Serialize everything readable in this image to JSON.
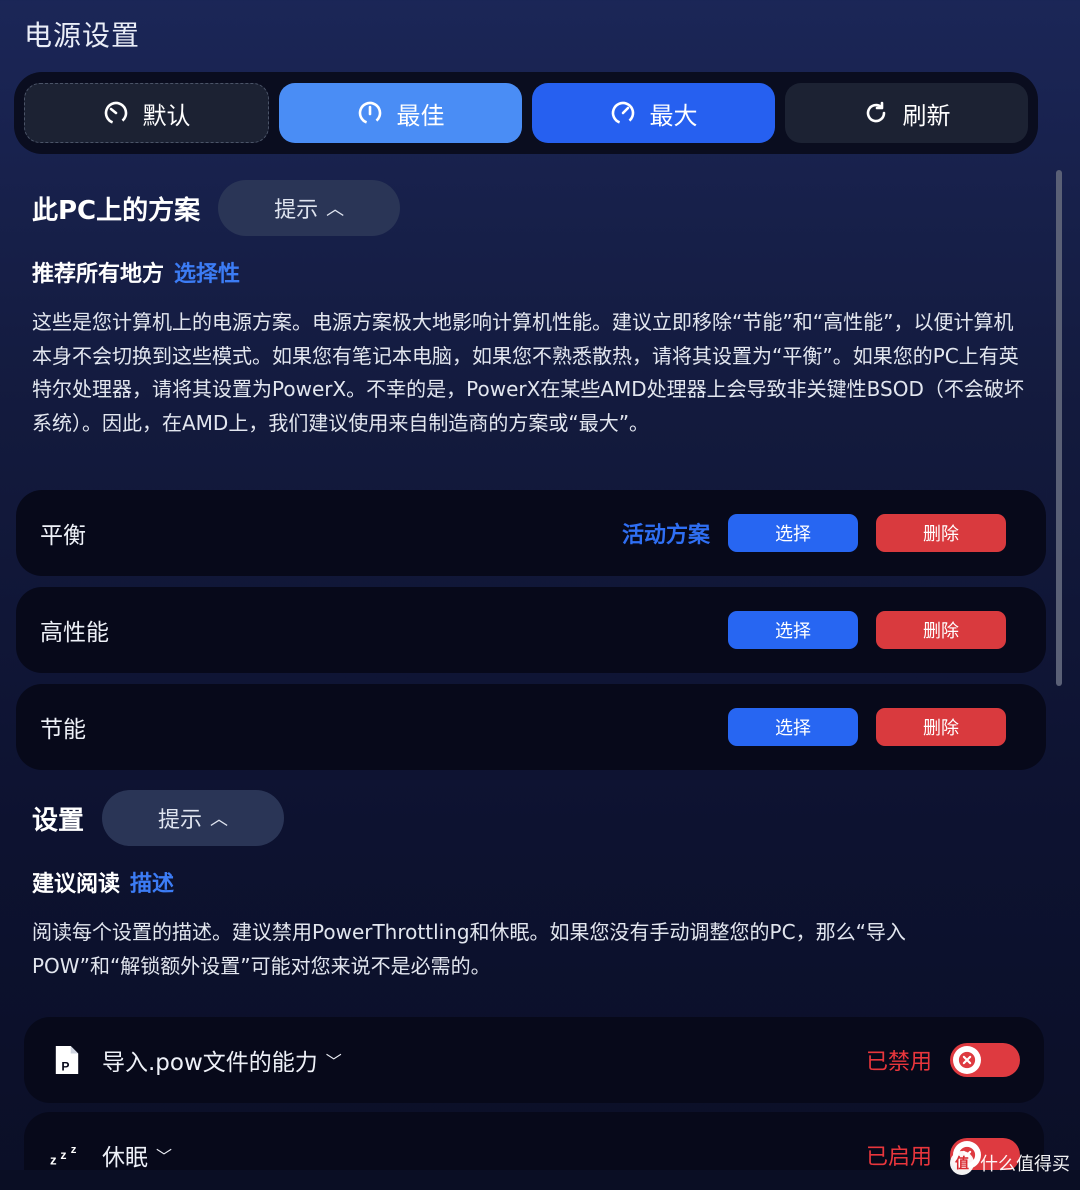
{
  "page": {
    "title": "电源设置"
  },
  "modes": [
    {
      "label": "默认",
      "icon": "gauge-low-icon"
    },
    {
      "label": "最佳",
      "icon": "gauge-mid-icon"
    },
    {
      "label": "最大",
      "icon": "gauge-high-icon"
    },
    {
      "label": "刷新",
      "icon": "refresh-icon"
    }
  ],
  "plans_section": {
    "title": "此PC上的方案",
    "hint_label": "提示",
    "recommend_label": "推荐所有地方",
    "recommend_link": "选择性",
    "description": "这些是您计算机上的电源方案。电源方案极大地影响计算机性能。建议立即移除“节能”和“高性能”，以便计算机本身不会切换到这些模式。如果您有笔记本电脑，如果您不熟悉散热，请将其设置为“平衡”。如果您的PC上有英特尔处理器，请将其设置为PowerX。不幸的是，PowerX在某些AMD处理器上会导致非关键性BSOD（不会破坏系统）。因此，在AMD上，我们建议使用来自制造商的方案或“最大”。",
    "plans": [
      {
        "name": "平衡",
        "active_label": "活动方案",
        "select_label": "选择",
        "delete_label": "删除"
      },
      {
        "name": "高性能",
        "active_label": "",
        "select_label": "选择",
        "delete_label": "删除"
      },
      {
        "name": "节能",
        "active_label": "",
        "select_label": "选择",
        "delete_label": "删除"
      }
    ]
  },
  "settings_section": {
    "title": "设置",
    "hint_label": "提示",
    "recommend_label": "建议阅读",
    "recommend_link": "描述",
    "description": "阅读每个设置的描述。建议禁用PowerThrottling和休眠。如果您没有手动调整您的PC，那么“导入POW”和“解锁额外设置”可能对您来说不是必需的。",
    "items": [
      {
        "name": "导入.pow文件的能力",
        "status": "已禁用",
        "icon": "pow-file-icon",
        "state": "off"
      },
      {
        "name": "休眠",
        "status": "已启用",
        "icon": "sleep-zzz-icon",
        "state": "on"
      }
    ]
  },
  "watermark": {
    "text": "什么值得买",
    "badge": "值"
  },
  "colors": {
    "accent_blue": "#2766f2",
    "best_blue": "#4a8df5",
    "danger_red": "#d93a3e",
    "link_blue": "#3c7cf5"
  }
}
